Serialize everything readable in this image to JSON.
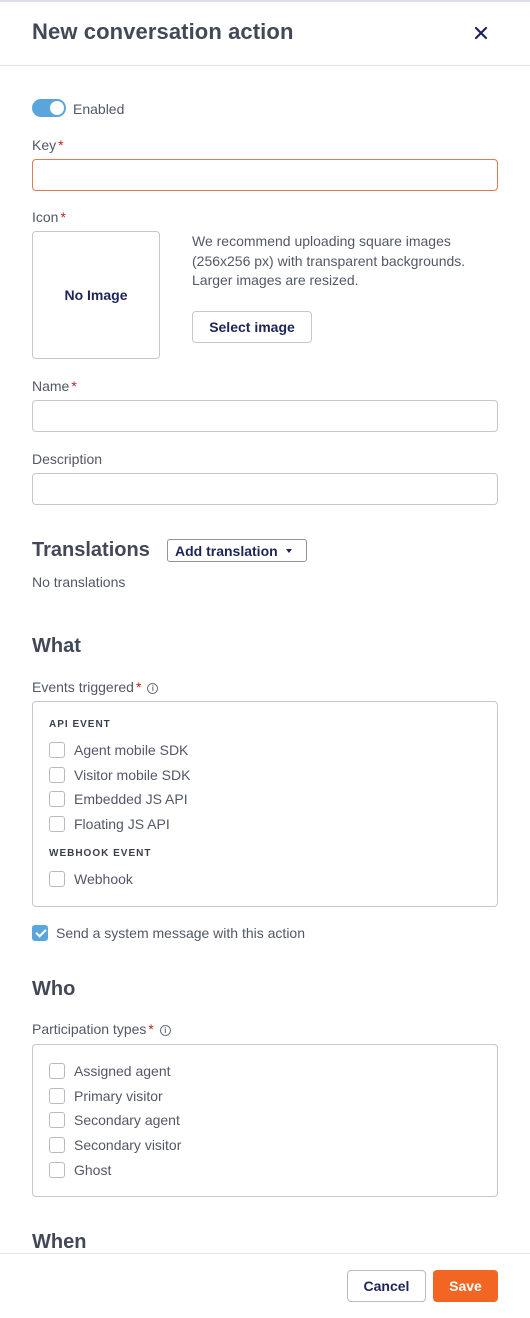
{
  "header": {
    "title": "New conversation action",
    "close_icon": "close-icon"
  },
  "form": {
    "enabled_label": "Enabled",
    "enabled": true,
    "key_label": "Key",
    "required_mark": "*",
    "key_value": "",
    "icon_label": "Icon",
    "icon_placeholder": "No Image",
    "icon_help": "We recommend uploading square images (256x256 px) with transparent backgrounds. Larger images are resized.",
    "select_image_label": "Select image",
    "name_label": "Name",
    "name_value": "",
    "description_label": "Description",
    "description_value": ""
  },
  "translations": {
    "title": "Translations",
    "add_label": "Add translation",
    "empty_text": "No translations"
  },
  "what": {
    "title": "What",
    "events_label": "Events triggered",
    "api_heading": "API EVENT",
    "api_events": [
      {
        "label": "Agent mobile SDK",
        "checked": false
      },
      {
        "label": "Visitor mobile SDK",
        "checked": false
      },
      {
        "label": "Embedded JS API",
        "checked": false
      },
      {
        "label": "Floating JS API",
        "checked": false
      }
    ],
    "webhook_heading": "WEBHOOK EVENT",
    "webhook_events": [
      {
        "label": "Webhook",
        "checked": false
      }
    ],
    "system_message_label": "Send a system message with this action",
    "system_message_checked": true
  },
  "who": {
    "title": "Who",
    "participation_label": "Participation types",
    "types": [
      {
        "label": "Assigned agent",
        "checked": false
      },
      {
        "label": "Primary visitor",
        "checked": false
      },
      {
        "label": "Secondary agent",
        "checked": false
      },
      {
        "label": "Secondary visitor",
        "checked": false
      },
      {
        "label": "Ghost",
        "checked": false
      }
    ]
  },
  "when": {
    "title": "When"
  },
  "footer": {
    "cancel_label": "Cancel",
    "save_label": "Save"
  },
  "colors": {
    "accent": "#5aa6dc",
    "primary_button": "#f26522",
    "error_border": "#e07a4f",
    "required": "#b3261e"
  }
}
